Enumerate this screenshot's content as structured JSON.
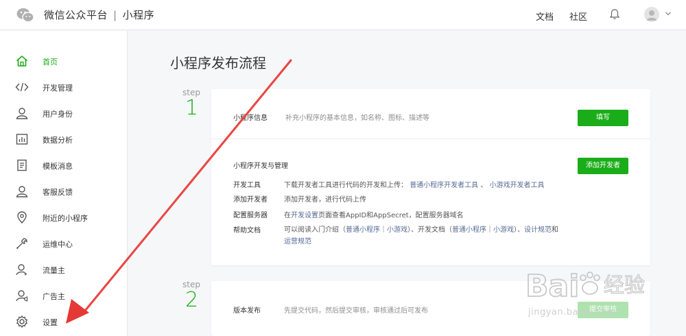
{
  "header": {
    "logo_icon": "wechat-logo-icon",
    "brand_name": "微信公众平台",
    "separator": "|",
    "product": "小程序",
    "docs_link": "文档",
    "community_link": "社区",
    "bell_icon": "bell-icon",
    "avatar_icon": "avatar-icon",
    "chevron_icon": "chevron-down-icon"
  },
  "sidebar": {
    "items": [
      {
        "label": "首页",
        "icon": "home-icon",
        "active": true
      },
      {
        "label": "开发管理",
        "icon": "code-icon"
      },
      {
        "label": "用户身份",
        "icon": "user-icon"
      },
      {
        "label": "数据分析",
        "icon": "bar-chart-icon"
      },
      {
        "label": "模板消息",
        "icon": "document-icon"
      },
      {
        "label": "客服反馈",
        "icon": "support-user-icon"
      },
      {
        "label": "附近的小程序",
        "icon": "location-pin-icon"
      },
      {
        "label": "运维中心",
        "icon": "wrench-icon"
      },
      {
        "label": "流量主",
        "icon": "traffic-user-icon"
      },
      {
        "label": "广告主",
        "icon": "ad-user-icon"
      },
      {
        "label": "设置",
        "icon": "gear-icon"
      }
    ]
  },
  "main": {
    "title": "小程序发布流程",
    "steps": [
      {
        "word": "step",
        "number": "1",
        "info": {
          "label": "小程序信息",
          "desc": "补充小程序的基本信息，如名称、图标、描述等",
          "button": "填写"
        },
        "dev": {
          "heading": "小程序开发与管理",
          "button": "添加开发者",
          "rows": [
            {
              "label": "开发工具",
              "text": "下载开发者工具进行代码的开发和上传：",
              "link1": "普通小程序开发者工具",
              "sep": "、",
              "link2": "小游戏开发者工具"
            },
            {
              "label": "添加开发者",
              "text": "添加开发者，进行代码上传"
            },
            {
              "label": "配置服务器",
              "pre": "在",
              "link": "开发设置",
              "post": "页面查看AppID和AppSecret，配置服务器域名"
            },
            {
              "label": "帮助文档",
              "p1": "可以阅读入门介绍（",
              "l1": "普通小程序",
              "p2": "｜",
              "l2": "小游戏",
              "p3": "）、开发文档（",
              "l3": "普通小程序",
              "p4": "｜",
              "l4": "小游戏",
              "p5": "）、",
              "l5": "设计规范",
              "p6": "和",
              "l6": "运营规范"
            }
          ]
        }
      },
      {
        "word": "step",
        "number": "2",
        "release": {
          "label": "版本发布",
          "desc": "先提交代码，然后提交审核，审核通过后可发布",
          "button": "提交审核"
        }
      }
    ]
  },
  "watermark": {
    "text": "Bai",
    "paw": "paw-icon",
    "cn": "经验",
    "url": "jingyan.baidu.com"
  },
  "colors": {
    "accent": "#1aad19",
    "link": "#576b95",
    "arrow": "#e53935"
  }
}
